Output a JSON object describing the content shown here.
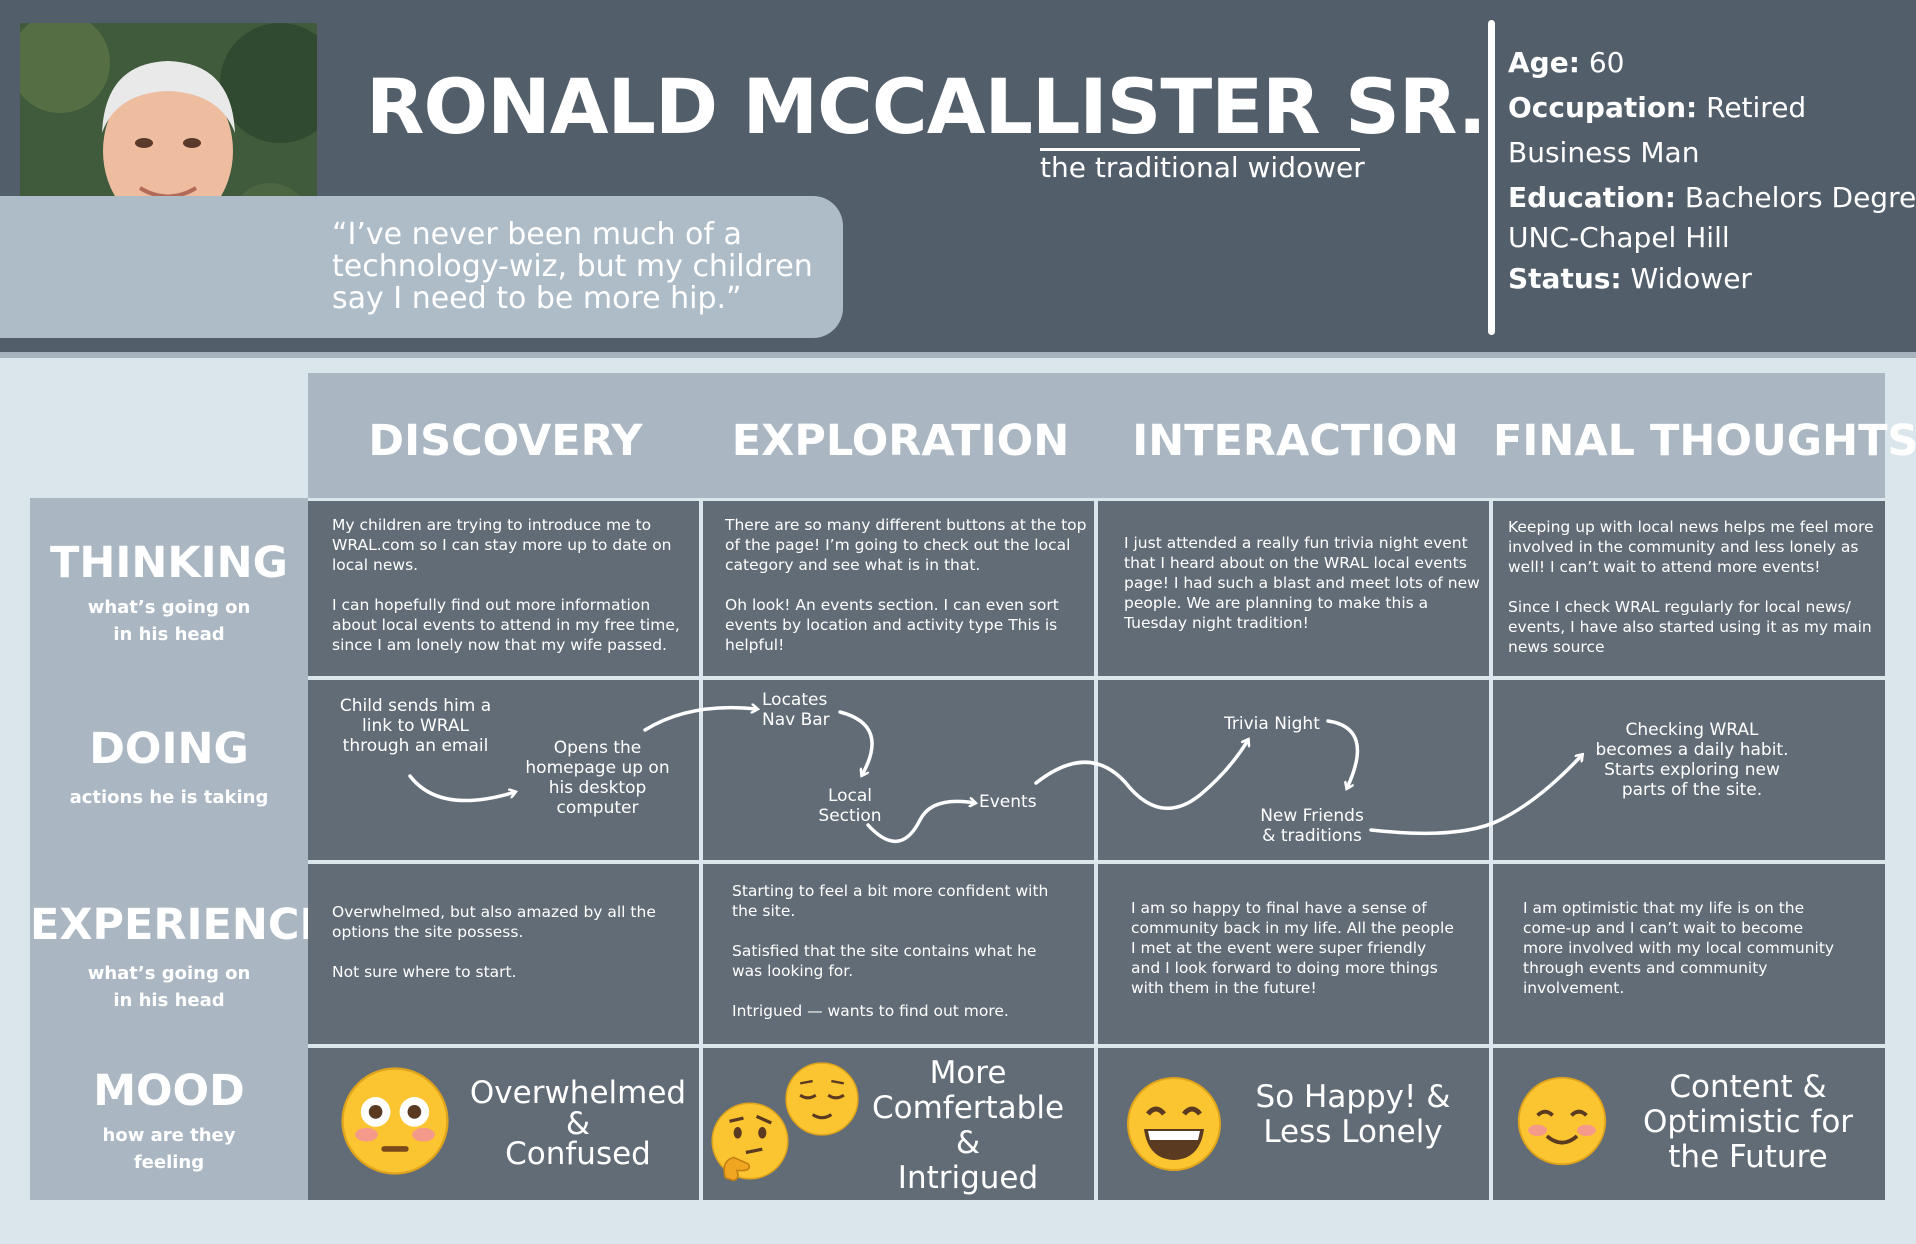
{
  "persona": {
    "name": "RONALD MCCALLISTER SR.",
    "subtitle": "the traditional widower",
    "quote_lines": [
      "“I’ve never been much of a",
      "technology-wiz, but my children",
      "say I need to be more hip.”"
    ],
    "facts": {
      "age_label": "Age:",
      "age_value": "60",
      "occupation_label": "Occupation:",
      "occupation_value": "Retired",
      "occupation_value2": "Business Man",
      "education_label": "Education:",
      "education_value": "Bachelors Degree",
      "education_value2": "UNC-Chapel Hill",
      "status_label": "Status:",
      "status_value": "Widower"
    }
  },
  "columns": [
    "DISCOVERY",
    "EXPLORATION",
    "INTERACTION",
    "FINAL THOUGHTS"
  ],
  "rows": {
    "thinking": {
      "title": "THINKING",
      "sub1": "what’s going on",
      "sub2": "in his head"
    },
    "doing": {
      "title": "DOING",
      "sub1": "actions he is taking"
    },
    "experience": {
      "title": "EXPERIENCE",
      "sub1": "what’s going on",
      "sub2": "in his head"
    },
    "mood": {
      "title": "MOOD",
      "sub1": "how are they",
      "sub2": "feeling"
    }
  },
  "thinking": [
    [
      "My children are trying to introduce me to",
      "WRAL.com so I can stay more up to date on",
      "local news.",
      "",
      "I can hopefully find out more information",
      "about local events to attend in my free time,",
      "since I am lonely now that my wife passed."
    ],
    [
      "There are so many different buttons at the top",
      "of the page! I’m going to check out the local",
      "category and see what is in that.",
      "",
      "Oh look! An events section. I can even sort",
      "events by location and activity type This is",
      "helpful!"
    ],
    [
      "I just attended a really fun trivia night event",
      "that I heard about on the WRAL local events",
      "page! I had such a blast and meet lots of new",
      "people. We are planning to make this a",
      "Tuesday night tradition!"
    ],
    [
      "Keeping up with local news helps me feel more",
      "involved in the community and less lonely as",
      "well! I can’t wait to attend more events!",
      "",
      "Since I check WRAL regularly for local news/",
      "events, I have also started using it as my main",
      "news source"
    ]
  ],
  "doing": {
    "child_sends": [
      "Child sends him a",
      "link to WRAL",
      "through an email"
    ],
    "opens": [
      "Opens the",
      "homepage up on",
      "his desktop",
      "computer"
    ],
    "locates": [
      "Locates",
      "Nav Bar"
    ],
    "local_section": [
      "Local",
      "Section"
    ],
    "events": "Events",
    "trivia": "Trivia Night",
    "friends": [
      "New Friends",
      "& traditions"
    ],
    "checking": [
      "Checking WRAL",
      "becomes a daily habit.",
      "Starts exploring new",
      "parts of the site."
    ]
  },
  "experience": [
    [
      "Overwhelmed, but also amazed by all the",
      "options the site possess.",
      "",
      "Not sure where to start."
    ],
    [
      "Starting to feel a bit more confident with",
      "the site.",
      "",
      "Satisfied that the site contains what he",
      "was looking for.",
      "",
      "Intrigued — wants to find out more."
    ],
    [
      "I am so happy to final have a sense of",
      "community back in my life. All the people",
      "I met at the event were super friendly",
      "and I look forward to doing more things",
      "with them in the future!"
    ],
    [
      "I am optimistic that my life is on the",
      "come-up and I can’t wait to become",
      "more involved with my local community",
      "through events and community",
      "involvement."
    ]
  ],
  "mood": [
    [
      "Overwhelmed",
      "&",
      "Confused"
    ],
    [
      "More",
      "Comfertable",
      "&",
      "Intrigued"
    ],
    [
      "So Happy! &",
      "Less Lonely"
    ],
    [
      "Content &",
      "Optimistic for",
      "the Future"
    ]
  ],
  "emojis": [
    "flushed-face",
    "relieved-face",
    "thinking-face",
    "grinning-face",
    "smiling-face"
  ],
  "colors": {
    "header": "#525e6a",
    "cell": "#616c76",
    "label": "#aab7c2",
    "background": "#dbe5ec"
  }
}
